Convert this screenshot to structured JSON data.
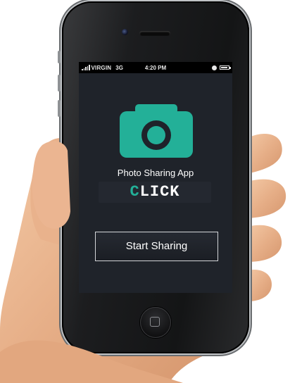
{
  "status_bar": {
    "carrier": "VIRGIN",
    "network": "3G",
    "time": "4:20 PM"
  },
  "app": {
    "name": "Photo Sharing App",
    "logo_first_letter": "C",
    "logo_rest": "LICK",
    "start_button_label": "Start Sharing"
  },
  "colors": {
    "accent": "#23b098",
    "screen_background": "#1f232a",
    "status_bar": "#000000"
  },
  "icons": {
    "app_icon": "camera-icon",
    "home_button": "home-button"
  }
}
